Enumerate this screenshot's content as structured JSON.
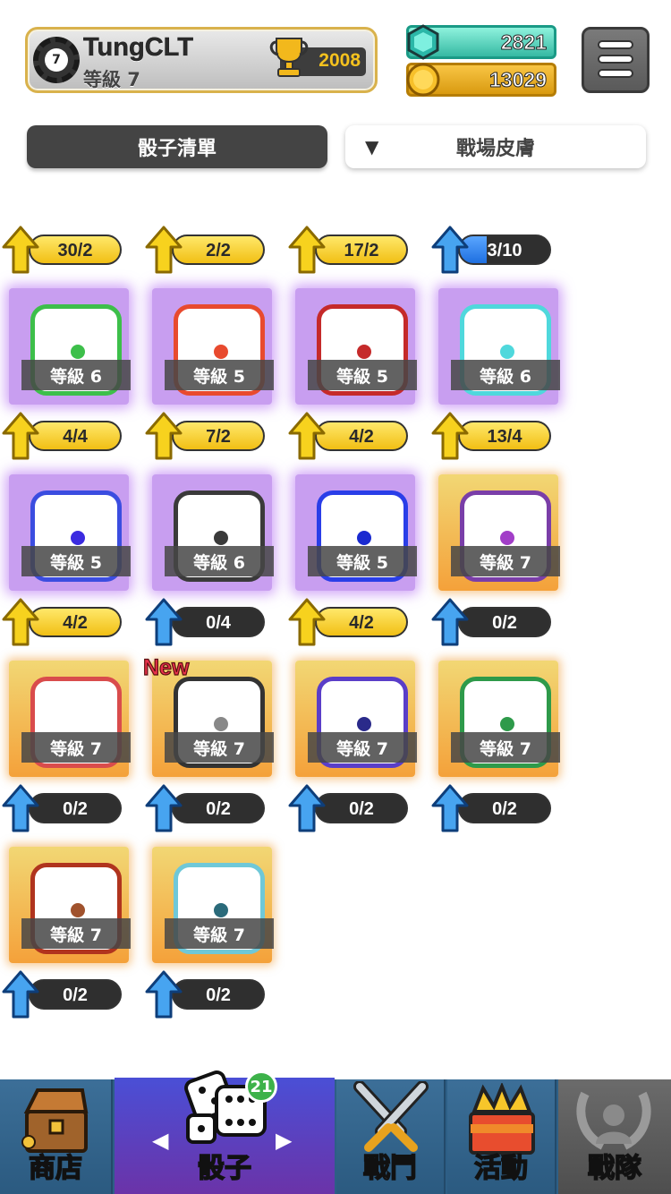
{
  "player": {
    "name": "TungCLT",
    "level_label": "等級 7",
    "rank_number": "7",
    "trophies": "2008"
  },
  "resources": {
    "gems": "2821",
    "coins": "13029",
    "coin_symbol": "C"
  },
  "tabs": {
    "dice_list": "骰子清單",
    "battlefield_skin": "戰場皮膚",
    "dropdown_arrow": "▼"
  },
  "dice": [
    {
      "progress": "30/2",
      "progress_fraction": 1.0,
      "bar": "yellow",
      "arrow": "yellow",
      "row": 0,
      "col": 0,
      "partial": true
    },
    {
      "progress": "2/2",
      "progress_fraction": 1.0,
      "bar": "yellow",
      "arrow": "yellow",
      "row": 0,
      "col": 1,
      "partial": true
    },
    {
      "progress": "17/2",
      "progress_fraction": 1.0,
      "bar": "yellow",
      "arrow": "yellow",
      "row": 0,
      "col": 2,
      "partial": true
    },
    {
      "progress": "3/10",
      "progress_fraction": 0.3,
      "bar": "blue",
      "arrow": "blue",
      "row": 0,
      "col": 3,
      "partial": true
    },
    {
      "level": "等級 6",
      "progress": "4/4",
      "progress_fraction": 1.0,
      "bar": "yellow",
      "arrow": "yellow",
      "frame": "purple",
      "border": "#3dbf4a",
      "pip": "#3dbf4a",
      "row": 1,
      "col": 0
    },
    {
      "level": "等級 5",
      "progress": "7/2",
      "progress_fraction": 1.0,
      "bar": "yellow",
      "arrow": "yellow",
      "frame": "purple",
      "border": "#e84a2e",
      "pip": "#e84a2e",
      "row": 1,
      "col": 1
    },
    {
      "level": "等級 5",
      "progress": "4/2",
      "progress_fraction": 1.0,
      "bar": "yellow",
      "arrow": "yellow",
      "frame": "purple",
      "border": "#c52a2a",
      "pip": "#c52a2a",
      "row": 1,
      "col": 2
    },
    {
      "level": "等級 6",
      "progress": "13/4",
      "progress_fraction": 1.0,
      "bar": "yellow",
      "arrow": "yellow",
      "frame": "purple",
      "border": "#4fd8dc",
      "pip": "#4fd8dc",
      "row": 1,
      "col": 3
    },
    {
      "level": "等級 5",
      "progress": "4/2",
      "progress_fraction": 1.0,
      "bar": "yellow",
      "arrow": "yellow",
      "frame": "purple",
      "border": "#3b4de0",
      "pip": "#3b2be0",
      "row": 2,
      "col": 0
    },
    {
      "level": "等級 6",
      "progress": "0/4",
      "progress_fraction": 0.0,
      "bar": "blue",
      "arrow": "blue",
      "frame": "purple",
      "border": "#3a3a3a",
      "pip": "#3a3a3a",
      "row": 2,
      "col": 1
    },
    {
      "level": "等級 5",
      "progress": "4/2",
      "progress_fraction": 1.0,
      "bar": "yellow",
      "arrow": "yellow",
      "frame": "purple",
      "border": "#2a3ee8",
      "pip": "#1a2ad0",
      "row": 2,
      "col": 2
    },
    {
      "level": "等級 7",
      "progress": "0/2",
      "progress_fraction": 0.0,
      "bar": "blue",
      "arrow": "blue",
      "frame": "gold",
      "border": "#7a3ea8",
      "pip": "#a23ec8",
      "row": 2,
      "col": 3
    },
    {
      "level": "等級 7",
      "progress": "0/2",
      "progress_fraction": 0.0,
      "bar": "blue",
      "arrow": "blue",
      "frame": "gold",
      "border": "#d94c4c",
      "pip": "#ffffff",
      "row": 3,
      "col": 0
    },
    {
      "level": "等級 7",
      "progress": "0/2",
      "progress_fraction": 0.0,
      "bar": "blue",
      "arrow": "blue",
      "frame": "gold",
      "border": "#333333",
      "pip": "#888888",
      "row": 3,
      "col": 1,
      "new": "New"
    },
    {
      "level": "等級 7",
      "progress": "0/2",
      "progress_fraction": 0.0,
      "bar": "blue",
      "arrow": "blue",
      "frame": "gold",
      "border": "#5a3ec8",
      "pip": "#2a2a8a",
      "row": 3,
      "col": 2
    },
    {
      "level": "等級 7",
      "progress": "0/2",
      "progress_fraction": 0.0,
      "bar": "blue",
      "arrow": "blue",
      "frame": "gold",
      "border": "#2e9a4a",
      "pip": "#2e9a4a",
      "row": 3,
      "col": 3
    },
    {
      "level": "等級 7",
      "progress": "0/2",
      "progress_fraction": 0.0,
      "bar": "blue",
      "arrow": "blue",
      "frame": "gold",
      "border": "#b0341e",
      "pip": "#a0522d",
      "row": 4,
      "col": 0
    },
    {
      "level": "等級 7",
      "progress": "0/2",
      "progress_fraction": 0.0,
      "bar": "blue",
      "arrow": "blue",
      "frame": "gold",
      "border": "#6fc8d8",
      "pip": "#2a6a7a",
      "row": 4,
      "col": 1
    }
  ],
  "nav": {
    "shop": "商店",
    "dice": "骰子",
    "dice_badge": "21",
    "battle": "戰鬥",
    "event": "活動",
    "clan": "戰隊",
    "left_arrow": "◀",
    "right_arrow": "▶"
  },
  "colors": {
    "gold_text": "#f5c21e",
    "nav_bg": "#2d5f86",
    "dice_tab_active": "#444444"
  }
}
